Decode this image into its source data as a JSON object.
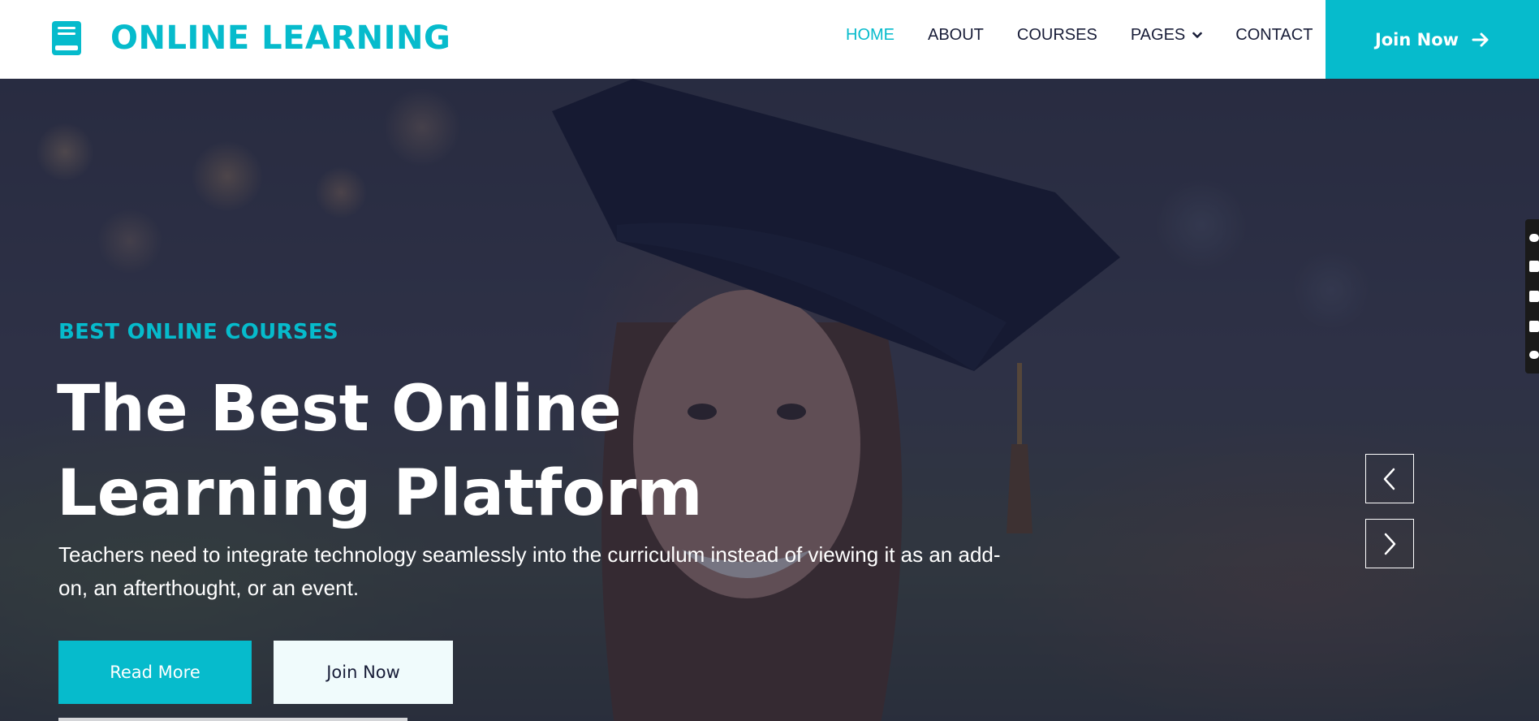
{
  "brand": {
    "name": "ONLINE LEARNING",
    "icon": "book-icon",
    "color": "#06bbcc"
  },
  "nav": {
    "items": [
      {
        "label": "HOME",
        "active": true
      },
      {
        "label": "ABOUT",
        "active": false
      },
      {
        "label": "COURSES",
        "active": false
      },
      {
        "label": "PAGES",
        "active": false,
        "dropdown": true
      },
      {
        "label": "CONTACT",
        "active": false
      }
    ],
    "cta_label": "Join Now",
    "cta_icon": "arrow-right-icon"
  },
  "hero": {
    "subtitle": "BEST ONLINE COURSES",
    "headline": "The Best Online Learning Platform",
    "lead": "Teachers need to integrate technology seamlessly into the curriculum instead of viewing it as an add-on, an afterthought, or an event.",
    "primary_button": "Read More",
    "secondary_button": "Join Now",
    "prev_icon": "chevron-left-icon",
    "next_icon": "chevron-right-icon",
    "background_image": "graduate woman in mortarboard cap smiling"
  },
  "colors": {
    "primary": "#06bbcc",
    "dark": "#181d38",
    "light": "#f0fbfc",
    "white": "#ffffff"
  }
}
